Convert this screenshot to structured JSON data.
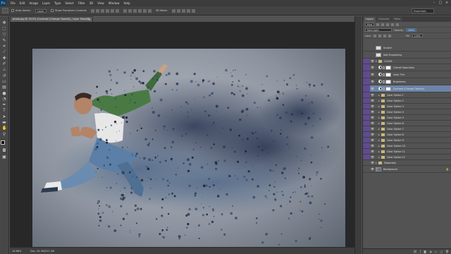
{
  "menu": {
    "logo": "Ps",
    "items": [
      "File",
      "Edit",
      "Image",
      "Layer",
      "Type",
      "Select",
      "Filter",
      "3D",
      "View",
      "Window",
      "Help"
    ]
  },
  "window_controls": {
    "minimize": "–",
    "maximize": "□",
    "close": "×"
  },
  "options_bar": {
    "auto_select_label": "Auto-Select:",
    "auto_select_value": "Layer",
    "show_transform_label": "Show Transform Controls",
    "mode_label": "3D Mode:",
    "workspace": "Essentials"
  },
  "document": {
    "tab_title": "photo.jpg @ 16.5% (Contrast (Change Opacity), Layer Mask/8)",
    "close": "×",
    "zoom": "16.66%",
    "doc_info": "Doc: 34.3M/297.4M"
  },
  "panel": {
    "tabs": [
      "Layers",
      "Channels",
      "Paths"
    ],
    "kind_label": "Kind",
    "blend_mode": "Hard Light",
    "opacity_label": "Opacity:",
    "opacity_value": "100%",
    "lock_label": "Lock:",
    "fill_label": "Fill:",
    "fill_value": "100%",
    "layers": [
      {
        "name": "Scratch",
        "visible": false,
        "type": "pixel",
        "color": "none",
        "indent": 0
      },
      {
        "name": "Add Sharpening",
        "visible": false,
        "type": "pixel",
        "color": "none",
        "indent": 0
      },
      {
        "name": "COLOR",
        "visible": true,
        "type": "group-open",
        "color": "violet",
        "indent": 0
      },
      {
        "name": "Overall Saturation",
        "visible": true,
        "type": "adjustment",
        "color": "violet",
        "indent": 1
      },
      {
        "name": "Color Tint",
        "visible": true,
        "type": "adjustment",
        "color": "violet",
        "indent": 1
      },
      {
        "name": "Brightness",
        "visible": true,
        "type": "adjustment",
        "color": "violet",
        "indent": 1
      },
      {
        "name": "Contrast (Change Opacity)",
        "visible": true,
        "type": "adjustment",
        "color": "violet",
        "indent": 1,
        "selected": true
      },
      {
        "name": "Color Option 1",
        "visible": true,
        "type": "group",
        "color": "violet",
        "indent": 1
      },
      {
        "name": "Color Option 2",
        "visible": true,
        "type": "group",
        "color": "violet",
        "indent": 1
      },
      {
        "name": "Color Option 3",
        "visible": true,
        "type": "group",
        "color": "violet",
        "indent": 1
      },
      {
        "name": "Color Option 4",
        "visible": true,
        "type": "group",
        "color": "violet",
        "indent": 1
      },
      {
        "name": "Color Option 5",
        "visible": true,
        "type": "group",
        "color": "violet",
        "indent": 1
      },
      {
        "name": "Color Option 6",
        "visible": true,
        "type": "group",
        "color": "violet",
        "indent": 1
      },
      {
        "name": "Color Option 7",
        "visible": true,
        "type": "group",
        "color": "violet",
        "indent": 1
      },
      {
        "name": "Color Option 8",
        "visible": true,
        "type": "group",
        "color": "violet",
        "indent": 1
      },
      {
        "name": "Color Option 9",
        "visible": true,
        "type": "group",
        "color": "violet",
        "indent": 1
      },
      {
        "name": "Color Option 10",
        "visible": true,
        "type": "group",
        "color": "violet",
        "indent": 1
      },
      {
        "name": "Color Option 11",
        "visible": true,
        "type": "group",
        "color": "violet",
        "indent": 1
      },
      {
        "name": "Color Option 12",
        "visible": true,
        "type": "group",
        "color": "violet",
        "indent": 1
      },
      {
        "name": "Dispersion",
        "visible": true,
        "type": "group",
        "color": "none",
        "indent": 0
      },
      {
        "name": "Background",
        "visible": true,
        "type": "background",
        "color": "none",
        "indent": 0
      }
    ]
  },
  "colors": {
    "panel_bg": "#535353",
    "selected_layer": "#6d84a9",
    "layer_color_violet": "#5f4c8f",
    "ps_blue": "#2fa3f7"
  }
}
